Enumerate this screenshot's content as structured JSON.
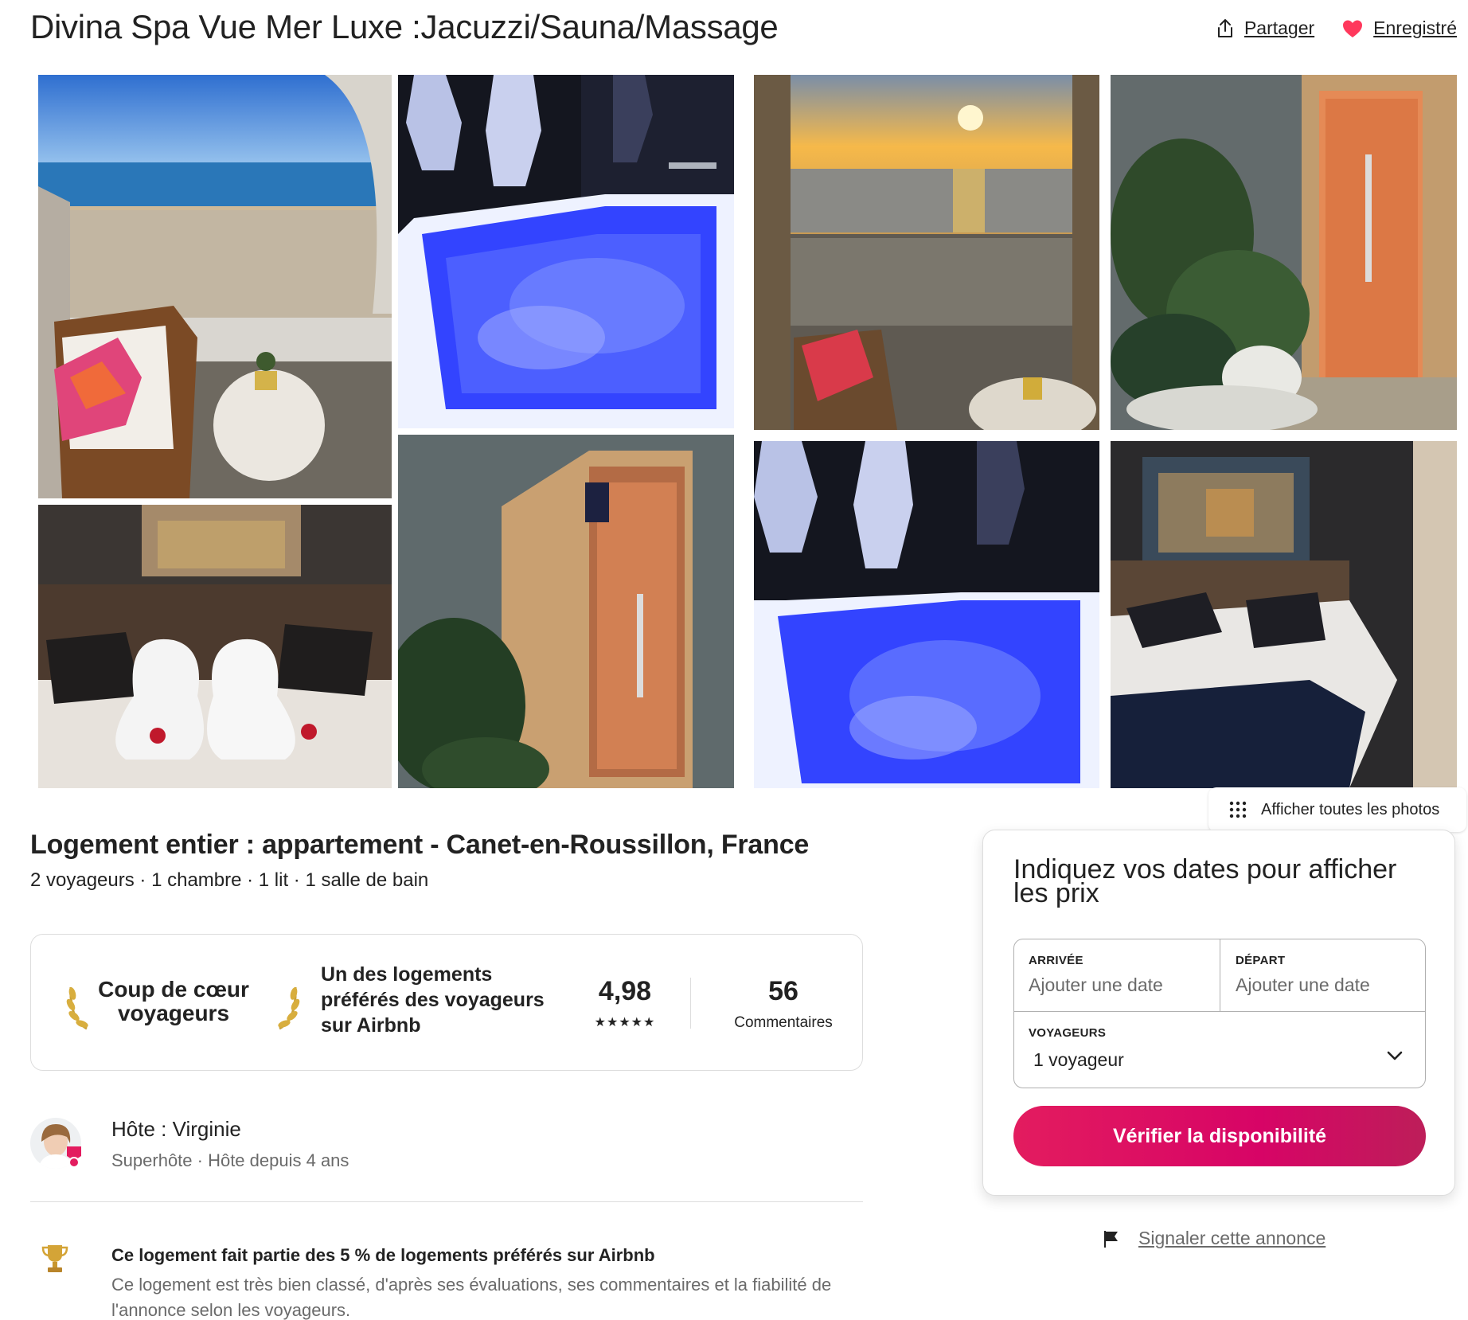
{
  "listing": {
    "title": "Divina Spa Vue Mer Luxe :Jacuzzi/Sauna/Massage",
    "share_label": "Partager",
    "saved_label": "Enregistré",
    "show_all_photos": "Afficher toutes les photos",
    "subtitle": "Logement entier : appartement - Canet-en-Roussillon, France",
    "details": "2 voyageurs · 1 chambre · 1 lit · 1 salle de bain"
  },
  "guest_favorite": {
    "badge_title": "Coup de cœur voyageurs",
    "description": "Un des logements préférés des voyageurs sur Airbnb",
    "rating": "4,98",
    "stars": "★★★★★",
    "reviews_count": "56",
    "reviews_label": "Commentaires"
  },
  "host": {
    "name": "Hôte : Virginie",
    "subtitle": "Superhôte · Hôte depuis 4 ans"
  },
  "highlight": {
    "title": "Ce logement fait partie des 5 % de logements préférés sur Airbnb",
    "description": "Ce logement est très bien classé, d'après ses évaluations, ses commentaires et la fiabilité de l'annonce selon les voyageurs."
  },
  "booking": {
    "title": "Indiquez vos dates pour afficher les prix",
    "checkin_label": "ARRIVÉE",
    "checkin_placeholder": "Ajouter une date",
    "checkout_label": "DÉPART",
    "checkout_placeholder": "Ajouter une date",
    "guests_label": "VOYAGEURS",
    "guests_value": "1 voyageur",
    "check_button": "Vérifier la disponibilité"
  },
  "report": {
    "label": "Signaler cette annonce"
  },
  "colors": {
    "brand": "#e31c5f",
    "heart": "#ff385c",
    "text": "#222222",
    "muted": "#6a6a6a"
  },
  "icons": [
    "share-icon",
    "heart-icon",
    "grid-dots-icon",
    "laurel-left-icon",
    "laurel-right-icon",
    "superhost-badge-icon",
    "trophy-icon",
    "chevron-down-icon",
    "flag-icon"
  ]
}
